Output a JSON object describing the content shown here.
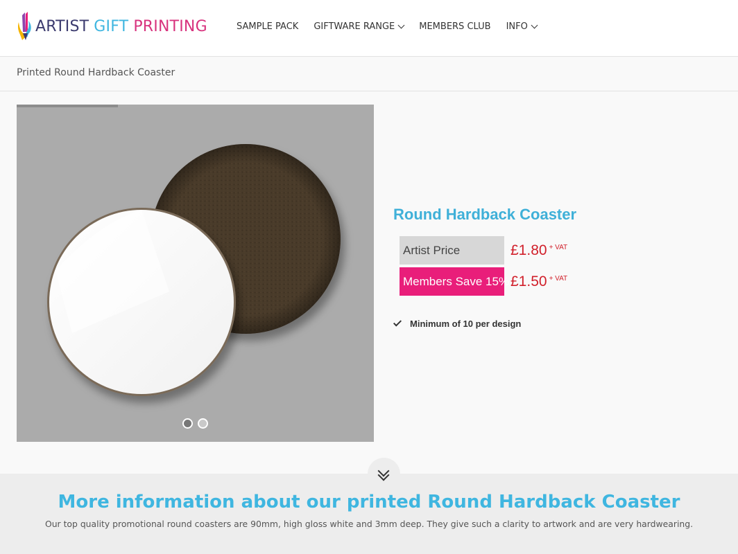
{
  "header": {
    "logo": {
      "word1": "ARTIST",
      "word2": "GIFT",
      "word3": "PRINTING"
    },
    "nav": [
      {
        "label": "SAMPLE PACK",
        "dropdown": false
      },
      {
        "label": "GIFTWARE RANGE",
        "dropdown": true
      },
      {
        "label": "MEMBERS CLUB",
        "dropdown": false
      },
      {
        "label": "INFO",
        "dropdown": true
      }
    ]
  },
  "breadcrumb": {
    "current": "Printed Round Hardback Coaster"
  },
  "gallery": {
    "slide_count": 2,
    "active_slide": 1
  },
  "product": {
    "title": "Round Hardback Coaster",
    "prices": [
      {
        "label": "Artist Price",
        "value": "£1.80",
        "suffix": "+ VAT"
      },
      {
        "label": "Members Save 15%",
        "value": "£1.50",
        "suffix": "+ VAT"
      }
    ],
    "features": [
      "Minimum of 10 per design"
    ]
  },
  "info": {
    "title": "More information about our printed Round Hardback Coaster",
    "description": "Our top quality promotional round coasters are 90mm, high gloss white and 3mm deep. They give such a clarity to artwork and are very hardwearing."
  },
  "colors": {
    "brand_blue": "#3fb6e0",
    "brand_pink": "#e91e7a",
    "price_red": "#d11f2a",
    "logo_navy": "#3b3a6e"
  },
  "icons": [
    "artist-brush-logo-icon",
    "chevron-down-icon",
    "check-icon",
    "double-chevron-down-icon"
  ]
}
